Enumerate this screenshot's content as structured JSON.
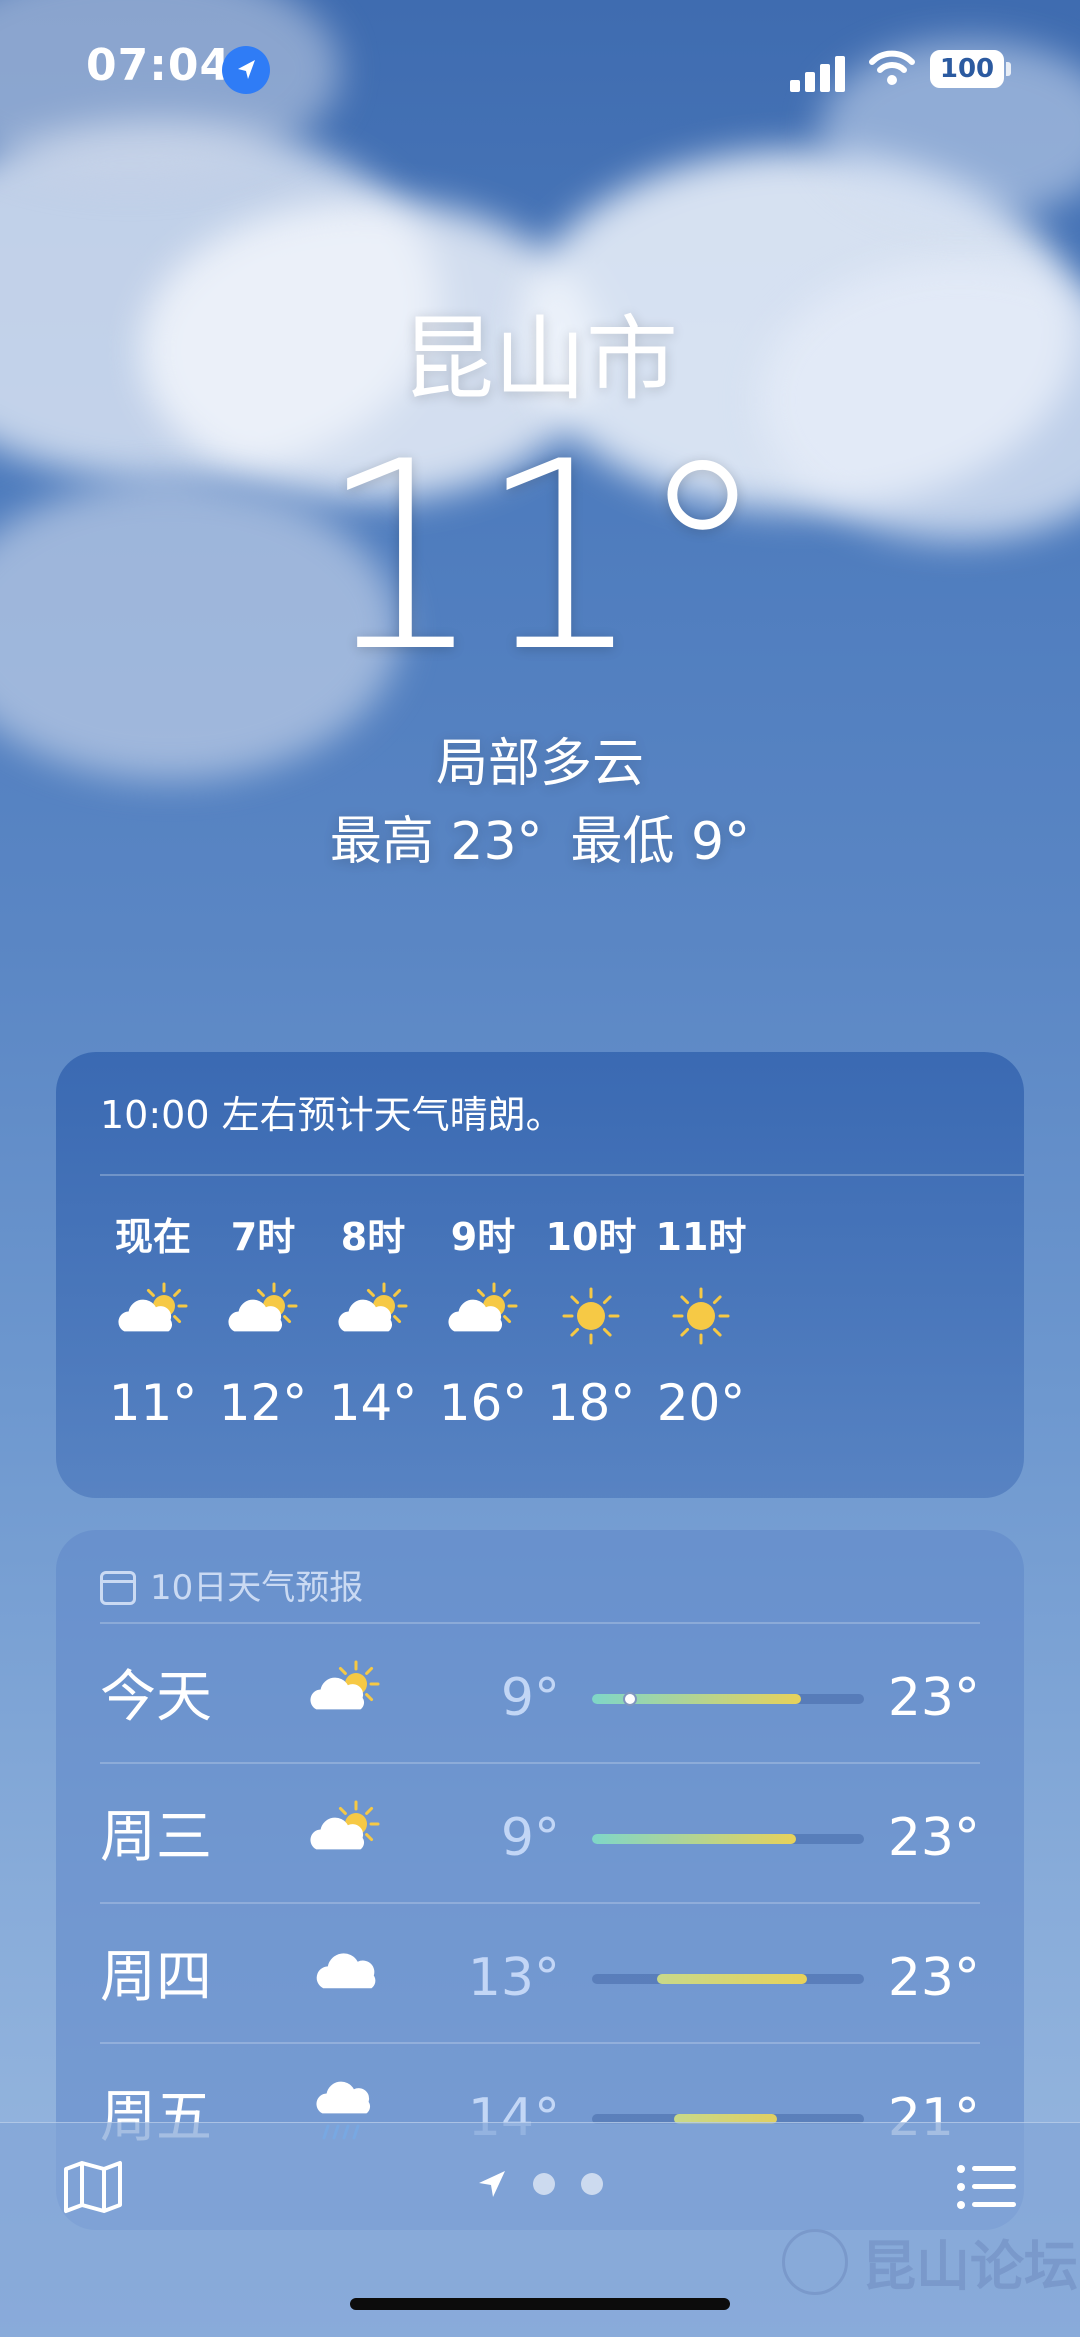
{
  "status_bar": {
    "time": "07:04",
    "battery": "100"
  },
  "location": {
    "city": "昆山市",
    "temperature": "11°",
    "condition": "局部多云",
    "high": "最高 23°",
    "low": "最低 9°"
  },
  "hourly": {
    "summary": "10:00 左右预计天气晴朗。",
    "items": [
      {
        "label": "现在",
        "icon": "partly-sunny-icon",
        "temp": "11°"
      },
      {
        "label": "7时",
        "icon": "partly-sunny-icon",
        "temp": "12°"
      },
      {
        "label": "8时",
        "icon": "partly-sunny-icon",
        "temp": "14°"
      },
      {
        "label": "9时",
        "icon": "partly-sunny-icon",
        "temp": "16°"
      },
      {
        "label": "10时",
        "icon": "sun-icon",
        "temp": "18°"
      },
      {
        "label": "11时",
        "icon": "sun-icon",
        "temp": "20°"
      }
    ]
  },
  "daily": {
    "title": "10日天气预报",
    "days": [
      {
        "name": "今天",
        "icon": "partly-sunny-icon",
        "low": "9°",
        "high": "23°"
      },
      {
        "name": "周三",
        "icon": "partly-sunny-icon",
        "low": "9°",
        "high": "23°"
      },
      {
        "name": "周四",
        "icon": "cloud-icon",
        "low": "13°",
        "high": "23°"
      },
      {
        "name": "周五",
        "icon": "rain-cloud-icon",
        "low": "14°",
        "high": "21°"
      }
    ]
  },
  "watermark": "昆山论坛",
  "colors": {
    "sun": "#f6c945",
    "bar_cool": "#7fd6c8",
    "bar_warm": "#e8d25a",
    "location_blue": "#2f7cf6"
  }
}
